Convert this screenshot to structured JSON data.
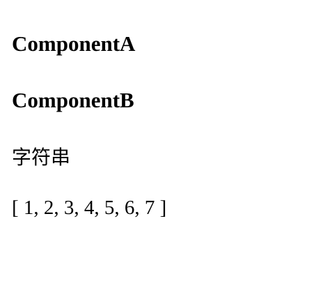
{
  "components": {
    "a_title": "ComponentA",
    "b_title": "ComponentB"
  },
  "content": {
    "string_text": "字符串",
    "array_text": "[ 1, 2, 3, 4, 5, 6, 7 ]"
  }
}
